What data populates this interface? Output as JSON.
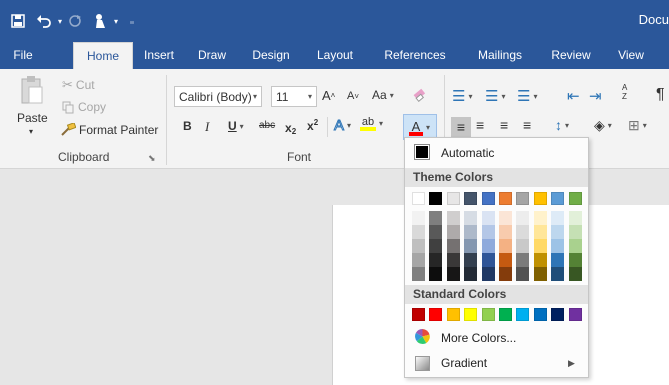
{
  "title_bar": {
    "doc_title": "Docu"
  },
  "tabs": [
    {
      "label": "File"
    },
    {
      "label": "Home"
    },
    {
      "label": "Insert"
    },
    {
      "label": "Draw"
    },
    {
      "label": "Design"
    },
    {
      "label": "Layout"
    },
    {
      "label": "References"
    },
    {
      "label": "Mailings"
    },
    {
      "label": "Review"
    },
    {
      "label": "View"
    }
  ],
  "active_tab": "Home",
  "clipboard": {
    "paste_label": "Paste",
    "cut_label": "Cut",
    "copy_label": "Copy",
    "format_painter_label": "Format Painter",
    "group_label": "Clipboard"
  },
  "font": {
    "font_name": "Calibri (Body)",
    "font_size": "11",
    "grow_label": "A",
    "shrink_label": "A",
    "case_label": "Aa",
    "bold_label": "B",
    "italic_label": "I",
    "underline_label": "U",
    "strike_label": "abc",
    "subscript_label": "x",
    "superscript_label": "x",
    "effects_label": "A",
    "highlight_label": "ab",
    "font_color_label": "A",
    "group_label": "Font"
  },
  "paragraph": {
    "sort_label": "A Z",
    "pilcrow_label": "¶"
  },
  "color_menu": {
    "automatic_label": "Automatic",
    "automatic_color": "#000000",
    "theme_header": "Theme Colors",
    "theme_colors": [
      {
        "base": "#ffffff",
        "shades": [
          "#f2f2f2",
          "#d9d9d9",
          "#bfbfbf",
          "#a6a6a6",
          "#808080"
        ]
      },
      {
        "base": "#000000",
        "shades": [
          "#7f7f7f",
          "#595959",
          "#404040",
          "#262626",
          "#0d0d0d"
        ]
      },
      {
        "base": "#e7e6e6",
        "shades": [
          "#d0cece",
          "#aeaaaa",
          "#757171",
          "#3a3838",
          "#171616"
        ]
      },
      {
        "base": "#44546a",
        "shades": [
          "#d6dce4",
          "#adb9ca",
          "#8497b0",
          "#333f4f",
          "#222a35"
        ]
      },
      {
        "base": "#4472c4",
        "shades": [
          "#dae3f3",
          "#b4c7e7",
          "#8faadc",
          "#2f5597",
          "#1f3864"
        ]
      },
      {
        "base": "#ed7d31",
        "shades": [
          "#fbe5d6",
          "#f8cbad",
          "#f4b183",
          "#c55a11",
          "#843c0c"
        ]
      },
      {
        "base": "#a5a5a5",
        "shades": [
          "#ededed",
          "#dbdbdb",
          "#c9c9c9",
          "#7b7b7b",
          "#525252"
        ]
      },
      {
        "base": "#ffc000",
        "shades": [
          "#fff2cc",
          "#ffe699",
          "#ffd966",
          "#bf9000",
          "#7f6000"
        ]
      },
      {
        "base": "#5b9bd5",
        "shades": [
          "#deebf7",
          "#bdd7ee",
          "#9dc3e6",
          "#2e75b6",
          "#1f4e79"
        ]
      },
      {
        "base": "#70ad47",
        "shades": [
          "#e2f0d9",
          "#c5e0b4",
          "#a9d18e",
          "#548235",
          "#385723"
        ]
      }
    ],
    "standard_header": "Standard Colors",
    "standard_colors": [
      "#c00000",
      "#ff0000",
      "#ffc000",
      "#ffff00",
      "#92d050",
      "#00b050",
      "#00b0f0",
      "#0070c0",
      "#002060",
      "#7030a0"
    ],
    "more_colors_label": "More Colors...",
    "gradient_label": "Gradient"
  }
}
